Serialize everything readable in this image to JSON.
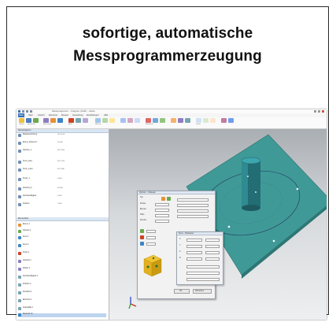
{
  "card": {
    "title_line1": "sofortige, automatische",
    "title_line2": "Messprogrammerzeugung"
  },
  "screenshot": {
    "window_title": "Messprogramm – Calypso (CAD) – Zeiss",
    "tabs": [
      "Datei",
      "Start",
      "Ansicht",
      "Elemente",
      "Messen",
      "Auswertung",
      "Einstellungen",
      "Hilfe"
    ],
    "ribbon_groups": [
      "Öffnen",
      "Speichern",
      "Import",
      "Ausrichten",
      "Messen",
      "Merkmale",
      "Auto",
      "Taster",
      "Plan"
    ],
    "tree_upper_header": "Messprogramm",
    "tree_upper_items": [
      {
        "label": "Basisausrichtung",
        "value": "X0 Y0 Z0"
      },
      {
        "label": "Ebene_Referenz",
        "value": "20.000"
      },
      {
        "label": "Zylinder_1",
        "value": "Ø 12.000"
      },
      {
        "label": "Kreis_oben",
        "value": "Ø 12.010"
      },
      {
        "label": "Kreis_unten",
        "value": "Ø 11.990"
      },
      {
        "label": "Punkt_1",
        "value": "0.000"
      },
      {
        "label": "Abstand_Z",
        "value": "45.000"
      },
      {
        "label": "Rechtwinkligkeit",
        "value": "0.020"
      },
      {
        "label": "Position",
        "value": "0.050"
      }
    ],
    "tree_lower_header": "Elementliste",
    "tree_lower_items": [
      {
        "label": "Ebene 1"
      },
      {
        "label": "Zylinder 1"
      },
      {
        "label": "Kreis 1"
      },
      {
        "label": "Kreis 2"
      },
      {
        "label": "Punkt 1"
      },
      {
        "label": "Abstand 1"
      },
      {
        "label": "Winkel 1"
      },
      {
        "label": "Rechtwinkligkeit 1"
      },
      {
        "label": "Position 1"
      },
      {
        "label": "Rundheit 1"
      },
      {
        "label": "Ebenheit 1"
      },
      {
        "label": "Koaxialität 1"
      },
      {
        "label": "Merkmal 13"
      }
    ],
    "dialog": {
      "title": "Zylinder – Strategie",
      "fields": [
        {
          "label": "Typ",
          "value": "Zylinder"
        },
        {
          "label": "Punkte",
          "value": "16"
        },
        {
          "label": "Ebenen",
          "value": "3"
        },
        {
          "label": "Höhe",
          "value": "45.000"
        },
        {
          "label": "Durchm.",
          "value": "12.000"
        }
      ],
      "ok_label": "OK",
      "cancel_label": "Abbrechen"
    },
    "dialog2": {
      "title": "Kreis – Parameter",
      "fields": [
        "X",
        "Y",
        "Z",
        "D"
      ]
    }
  }
}
